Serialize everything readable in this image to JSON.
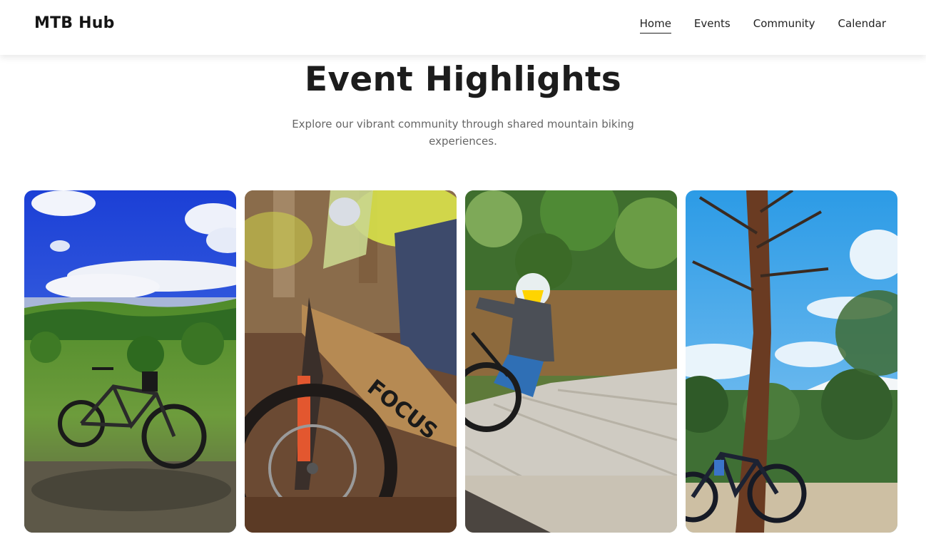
{
  "navbar": {
    "brand": "MTB Hub",
    "links": [
      "Home",
      "Events",
      "Community",
      "Calendar"
    ],
    "active_link": "Home"
  },
  "hero": {
    "title": "Event Highlights",
    "subtitle": "Explore our vibrant community through shared mountain biking experiences."
  },
  "gallery": {
    "photos": [
      {
        "name": "bike-on-hillside-photo"
      },
      {
        "name": "focus-bike-rider-photo"
      },
      {
        "name": "rider-on-wall-ride-photo"
      },
      {
        "name": "bike-under-tree-photo"
      }
    ]
  },
  "colors": {
    "text": "#1c1c1c",
    "muted": "#666666",
    "background": "#ffffff"
  }
}
